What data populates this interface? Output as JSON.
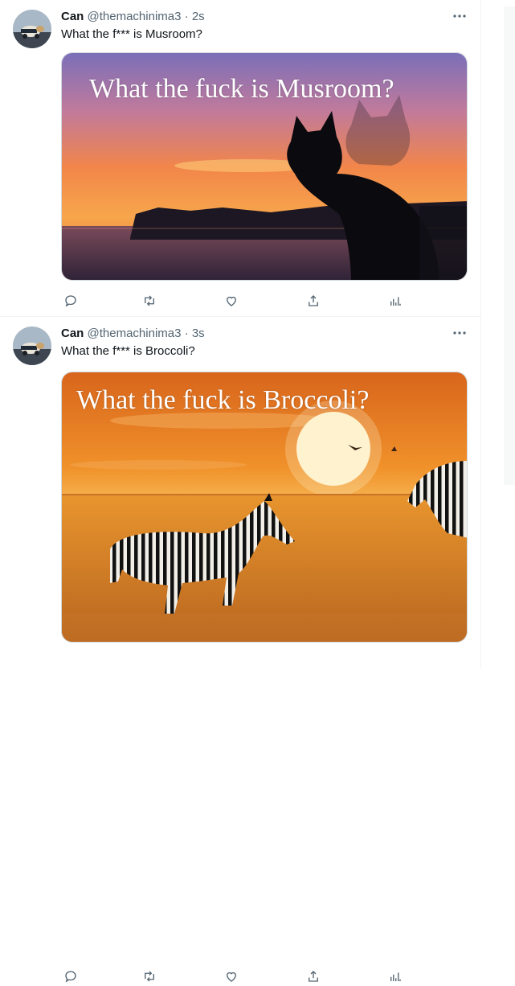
{
  "tweets": [
    {
      "author": {
        "display_name": "Can",
        "handle": "@themachinima3",
        "avatar_icon": "avatar-image"
      },
      "separator": "·",
      "time": "2s",
      "text": "What the f*** is Musroom?",
      "image": {
        "caption": "What the fuck is Musroom?",
        "scene": "sunset-sea-cat-silhouette"
      }
    },
    {
      "author": {
        "display_name": "Can",
        "handle": "@themachinima3",
        "avatar_icon": "avatar-image"
      },
      "separator": "·",
      "time": "3s",
      "text": "What the f*** is Broccoli?",
      "image": {
        "caption": "What the fuck is Broccoli?",
        "scene": "savanna-sunset-zebras"
      }
    }
  ],
  "action_icons": [
    "reply-icon",
    "retweet-icon",
    "like-icon",
    "share-icon",
    "analytics-icon"
  ],
  "colors": {
    "text_primary": "#0f1419",
    "text_secondary": "#536471",
    "border": "#eff3f4"
  }
}
